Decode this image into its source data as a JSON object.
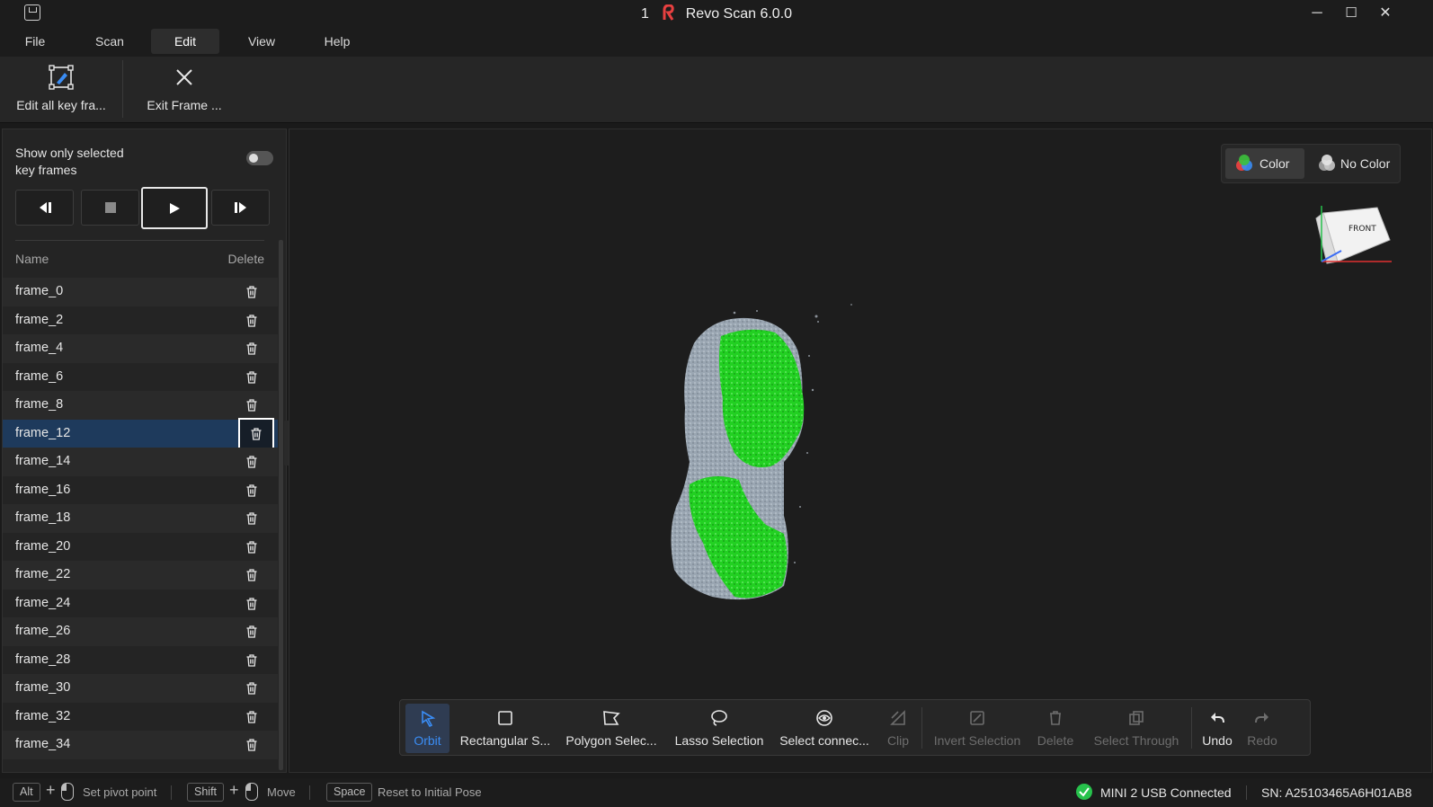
{
  "window": {
    "title_number": "1",
    "title": "Revo Scan 6.0.0",
    "minimize": "─",
    "maximize": "☐",
    "close": "✕"
  },
  "menu": {
    "items": [
      {
        "label": "File"
      },
      {
        "label": "Scan"
      },
      {
        "label": "Edit"
      },
      {
        "label": "View"
      },
      {
        "label": "Help"
      }
    ],
    "active": "Edit"
  },
  "ribbon": {
    "edit_all_label": "Edit all key fra...",
    "exit_frame_label": "Exit Frame ..."
  },
  "panel": {
    "toggle_label_line1": "Show only selected",
    "toggle_label_line2": "key frames",
    "toggle_on": false,
    "col_name": "Name",
    "col_delete": "Delete",
    "frames": [
      "frame_0",
      "frame_2",
      "frame_4",
      "frame_6",
      "frame_8",
      "frame_12",
      "frame_14",
      "frame_16",
      "frame_18",
      "frame_20",
      "frame_22",
      "frame_24",
      "frame_26",
      "frame_28",
      "frame_30",
      "frame_32",
      "frame_34"
    ],
    "selected_frame": "frame_12"
  },
  "viewport": {
    "color_label": "Color",
    "no_color_label": "No Color",
    "cube_label": "FRONT"
  },
  "toolbar": {
    "orbit": "Orbit",
    "rect": "Rectangular S...",
    "polygon": "Polygon Selec...",
    "lasso": "Lasso Selection",
    "connected": "Select connec...",
    "clip": "Clip",
    "invert": "Invert Selection",
    "delete": "Delete",
    "through": "Select Through",
    "undo": "Undo",
    "redo": "Redo"
  },
  "status": {
    "alt_key": "Alt",
    "pivot": "Set pivot point",
    "shift_key": "Shift",
    "move": "Move",
    "space_key": "Space",
    "reset": "Reset to Initial Pose",
    "connection": "MINI 2 USB Connected",
    "serial": "SN: A25103465A6H01AB8"
  },
  "colors": {
    "accent": "#3a8df5",
    "selected_row": "#1e3a5c",
    "scan_green": "#22d022",
    "scan_gray": "#9aa6b2",
    "connected": "#27c24c"
  }
}
